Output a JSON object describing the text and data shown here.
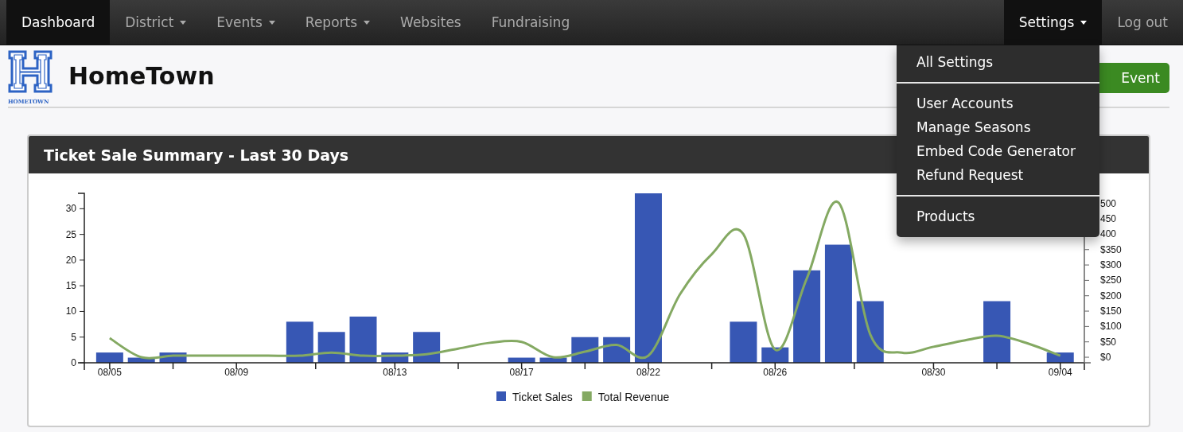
{
  "navbar": {
    "left": [
      {
        "label": "Dashboard",
        "selected": true,
        "dropdown": false
      },
      {
        "label": "District",
        "selected": false,
        "dropdown": true
      },
      {
        "label": "Events",
        "selected": false,
        "dropdown": true
      },
      {
        "label": "Reports",
        "selected": false,
        "dropdown": true
      },
      {
        "label": "Websites",
        "selected": false,
        "dropdown": false
      },
      {
        "label": "Fundraising",
        "selected": false,
        "dropdown": false
      }
    ],
    "right": [
      {
        "label": "Settings",
        "selected": true,
        "dropdown": true
      },
      {
        "label": "Log out",
        "selected": false,
        "dropdown": false
      }
    ]
  },
  "settings_menu": {
    "groups": [
      [
        "All Settings"
      ],
      [
        "User Accounts",
        "Manage Seasons",
        "Embed Code Generator",
        "Refund Request"
      ],
      [
        "Products"
      ]
    ]
  },
  "header": {
    "logo_caption": "HOMETOWN",
    "title": "HomeTown",
    "button": "Event"
  },
  "panel": {
    "title": "Ticket Sale Summary - Last 30 Days",
    "charts": [
      {
        "chart_data": {
          "type": "bar",
          "categories": [
            "08/05",
            null,
            null,
            null,
            "08/09",
            null,
            null,
            null,
            null,
            "08/13",
            null,
            null,
            null,
            "08/17",
            null,
            null,
            null,
            "08/22",
            null,
            null,
            null,
            "08/26",
            null,
            null,
            null,
            null,
            "08/30",
            null,
            null,
            null,
            "09/04"
          ],
          "ylim": [
            0,
            33
          ],
          "yticks": [
            0,
            5,
            10,
            15,
            20,
            25,
            30
          ],
          "series": [
            {
              "name": "Ticket Sales",
              "color": "#3757b4",
              "values": [
                2,
                1,
                2,
                0,
                0,
                0,
                8,
                6,
                9,
                2,
                6,
                0,
                0,
                1,
                1,
                5,
                5,
                33,
                0,
                0,
                8,
                3,
                18,
                23,
                12,
                0,
                0,
                0,
                12,
                0,
                2
              ]
            }
          ]
        }
      },
      {
        "chart_data": {
          "type": "line",
          "categories": [
            null,
            null,
            null,
            null,
            null,
            null,
            null,
            null,
            null,
            null,
            null,
            null,
            null,
            null,
            null,
            null,
            null,
            null,
            null,
            null,
            null,
            null,
            null,
            null,
            null,
            null,
            null,
            null,
            null,
            null,
            null
          ],
          "ylim": [
            -18,
            533
          ],
          "yticks": [
            {
              "value": 0,
              "label": "$0"
            },
            {
              "value": 50,
              "label": "$50"
            },
            {
              "value": 100,
              "label": "$100"
            },
            {
              "value": 150,
              "label": "$150"
            },
            {
              "value": 200,
              "label": "$200"
            },
            {
              "value": 250,
              "label": "$250"
            },
            {
              "value": 300,
              "label": "$300"
            },
            {
              "value": 350,
              "label": "$350"
            },
            {
              "value": 400,
              "label": "400"
            },
            {
              "value": 450,
              "label": "450"
            },
            {
              "value": 500,
              "label": "500"
            }
          ],
          "series": [
            {
              "name": "Total Revenue",
              "color": "#84a962",
              "values": [
                62,
                0,
                5,
                5,
                5,
                5,
                5,
                15,
                5,
                5,
                10,
                28,
                47,
                50,
                0,
                18,
                40,
                5,
                205,
                335,
                400,
                25,
                256,
                503,
                75,
                15,
                34,
                55,
                70,
                44,
                5
              ]
            }
          ]
        }
      }
    ]
  }
}
